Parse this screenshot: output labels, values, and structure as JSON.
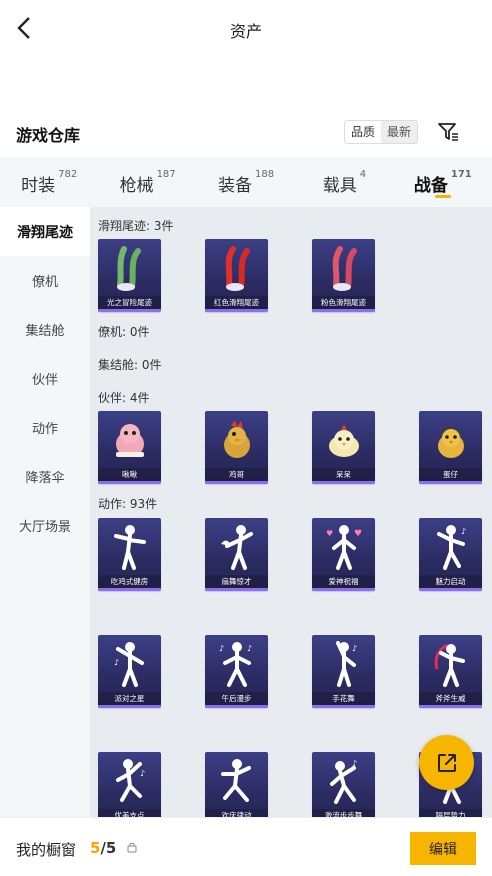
{
  "header": {
    "title": "资产"
  },
  "warehouse": {
    "title": "游戏仓库",
    "sort": {
      "quality": "品质",
      "newest": "最新"
    }
  },
  "tabs": [
    {
      "label": "时装",
      "count": "782",
      "active": false
    },
    {
      "label": "枪械",
      "count": "187",
      "active": false
    },
    {
      "label": "装备",
      "count": "188",
      "active": false
    },
    {
      "label": "载具",
      "count": "4",
      "active": false
    },
    {
      "label": "战备",
      "count": "171",
      "active": true
    }
  ],
  "sidebar": {
    "items": [
      {
        "label": "滑翔尾迹",
        "active": true
      },
      {
        "label": "僚机",
        "active": false
      },
      {
        "label": "集结舱",
        "active": false
      },
      {
        "label": "伙伴",
        "active": false
      },
      {
        "label": "动作",
        "active": false
      },
      {
        "label": "降落伞",
        "active": false
      },
      {
        "label": "大厅场景",
        "active": false
      }
    ]
  },
  "groups": {
    "trails": {
      "label": "滑翔尾迹: 3件",
      "items": [
        "光之冒险尾迹",
        "红色滑翔尾迹",
        "粉色滑翔尾迹"
      ]
    },
    "wingman": {
      "label": "僚机: 0件"
    },
    "pod": {
      "label": "集结舱: 0件"
    },
    "partners": {
      "label": "伙伴: 4件",
      "items": [
        "啾啾",
        "鸡哥",
        "呆呆",
        "蛋仔"
      ]
    },
    "actions": {
      "label": "动作: 93件",
      "items": [
        "吃鸡式健房",
        "扇舞惊才",
        "爱神祝福",
        "魅力启动",
        "派对之星",
        "午后漫步",
        "手花舞",
        "斧斧生威",
        "优美支点",
        "欢庆律动",
        "激流步步舞",
        "隔层势力"
      ]
    }
  },
  "colors": {
    "accent": "#f8b500",
    "card_bg": "#2b2b62",
    "card_stripe": "#8b6ef2"
  },
  "footer": {
    "label": "我的橱窗",
    "current": "5",
    "total": "/5",
    "edit": "编辑"
  },
  "icons": {
    "back": "chevron-left-icon",
    "filter": "filter-icon",
    "lock": "lock-icon",
    "share": "external-link-icon"
  }
}
